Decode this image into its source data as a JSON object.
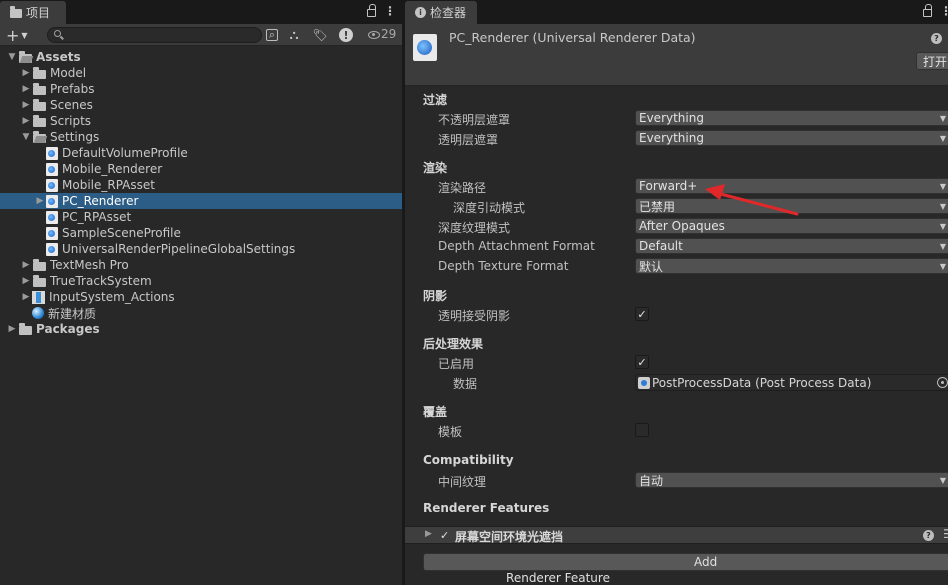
{
  "project": {
    "tab_label": "项目",
    "search_placeholder": "",
    "visible_count": "29",
    "tree": [
      {
        "label": "Assets",
        "depth": 0,
        "arrow": "▼",
        "icon": "folder-open",
        "bold": true
      },
      {
        "label": "Model",
        "depth": 1,
        "arrow": "▶",
        "icon": "folder"
      },
      {
        "label": "Prefabs",
        "depth": 1,
        "arrow": "▶",
        "icon": "folder"
      },
      {
        "label": "Scenes",
        "depth": 1,
        "arrow": "▶",
        "icon": "folder"
      },
      {
        "label": "Scripts",
        "depth": 1,
        "arrow": "▶",
        "icon": "folder"
      },
      {
        "label": "Settings",
        "depth": 1,
        "arrow": "▼",
        "icon": "folder-open"
      },
      {
        "label": "DefaultVolumeProfile",
        "depth": 2,
        "arrow": "",
        "icon": "asset"
      },
      {
        "label": "Mobile_Renderer",
        "depth": 2,
        "arrow": "",
        "icon": "asset"
      },
      {
        "label": "Mobile_RPAsset",
        "depth": 2,
        "arrow": "",
        "icon": "asset"
      },
      {
        "label": "PC_Renderer",
        "depth": 2,
        "arrow": "▶",
        "icon": "asset",
        "selected": true
      },
      {
        "label": "PC_RPAsset",
        "depth": 2,
        "arrow": "",
        "icon": "asset"
      },
      {
        "label": "SampleSceneProfile",
        "depth": 2,
        "arrow": "",
        "icon": "asset"
      },
      {
        "label": "UniversalRenderPipelineGlobalSettings",
        "depth": 2,
        "arrow": "",
        "icon": "asset"
      },
      {
        "label": "TextMesh Pro",
        "depth": 1,
        "arrow": "▶",
        "icon": "folder"
      },
      {
        "label": "TrueTrackSystem",
        "depth": 1,
        "arrow": "▶",
        "icon": "folder"
      },
      {
        "label": "InputSystem_Actions",
        "depth": 1,
        "arrow": "▶",
        "icon": "input-actions"
      },
      {
        "label": "新建材质",
        "depth": 1,
        "arrow": "",
        "icon": "material"
      },
      {
        "label": "Packages",
        "depth": 0,
        "arrow": "▶",
        "icon": "folder",
        "bold": true
      }
    ]
  },
  "inspector": {
    "tab_label": "检查器",
    "title": "PC_Renderer (Universal Renderer Data)",
    "open_button": "打开",
    "sections": {
      "filtering": {
        "title": "过滤",
        "opaque_mask_label": "不透明层遮罩",
        "opaque_mask_value": "Everything",
        "transparent_mask_label": "透明层遮罩",
        "transparent_mask_value": "Everything"
      },
      "rendering": {
        "title": "渲染",
        "rendering_path_label": "渲染路径",
        "rendering_path_value": "Forward+",
        "depth_priming_label": "深度引动模式",
        "depth_priming_value": "已禁用",
        "depth_texture_mode_label": "深度纹理模式",
        "depth_texture_mode_value": "After Opaques",
        "depth_attachment_label": "Depth Attachment Format",
        "depth_attachment_value": "Default",
        "depth_texture_format_label": "Depth Texture Format",
        "depth_texture_format_value": "默认"
      },
      "shadows": {
        "title": "阴影",
        "transparent_receive_label": "透明接受阴影",
        "transparent_receive_checked": "✓"
      },
      "post_processing": {
        "title": "后处理效果",
        "enabled_label": "已启用",
        "enabled_checked": "✓",
        "data_label": "数据",
        "data_value": "PostProcessData (Post Process Data)"
      },
      "overrides": {
        "title": "覆盖",
        "stencil_label": "模板",
        "stencil_checked": ""
      },
      "compatibility": {
        "title": "Compatibility",
        "intermediate_label": "中间纹理",
        "intermediate_value": "自动"
      },
      "features": {
        "title": "Renderer Features",
        "ssao_label": "屏幕空间环境光遮挡",
        "ssao_checked": "✓",
        "add_button": "Add Renderer Feature"
      }
    }
  },
  "colors": {
    "selection": "#2c5d87",
    "annotation_arrow": "#e0282a"
  }
}
